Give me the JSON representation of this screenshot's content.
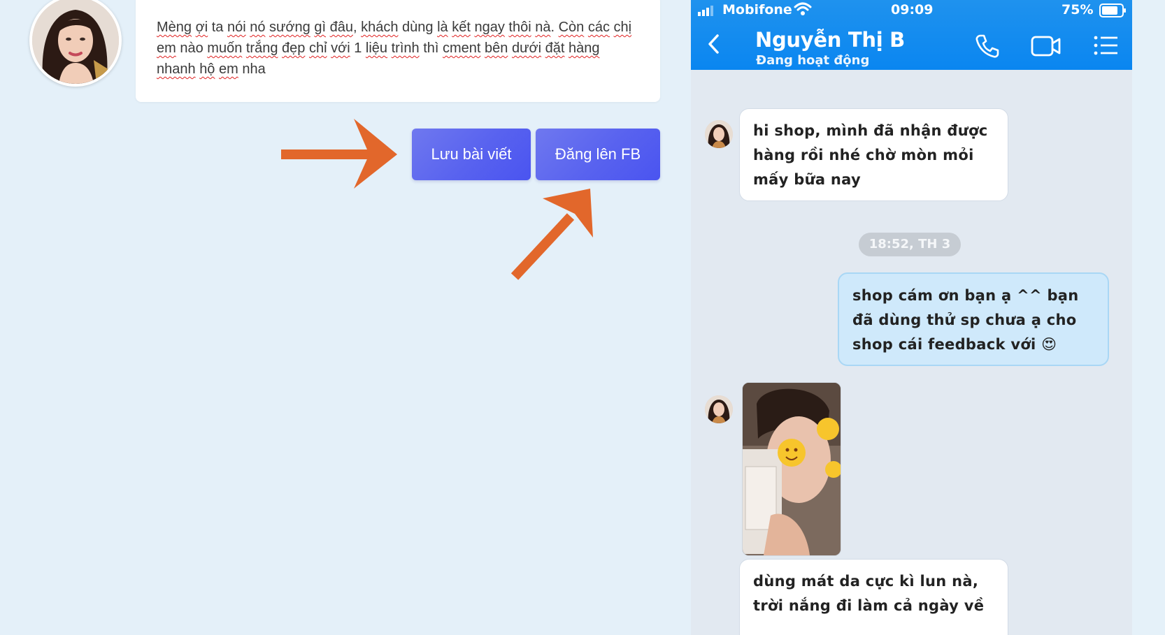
{
  "post": {
    "words": [
      {
        "t": "Mèng",
        "sp": true
      },
      {
        "t": " ",
        "sp": false
      },
      {
        "t": "ợi",
        "sp": true
      },
      {
        "t": " ta ",
        "sp": false
      },
      {
        "t": "nói",
        "sp": true
      },
      {
        "t": " ",
        "sp": false
      },
      {
        "t": "nó",
        "sp": true
      },
      {
        "t": " ",
        "sp": false
      },
      {
        "t": "sướng",
        "sp": true
      },
      {
        "t": " ",
        "sp": false
      },
      {
        "t": "gì",
        "sp": true
      },
      {
        "t": " ",
        "sp": false
      },
      {
        "t": "đâu",
        "sp": true
      },
      {
        "t": ", ",
        "sp": false
      },
      {
        "t": "khách",
        "sp": true
      },
      {
        "t": " dùng ",
        "sp": false
      },
      {
        "t": "là",
        "sp": true
      },
      {
        "t": " ",
        "sp": false
      },
      {
        "t": "kết",
        "sp": true
      },
      {
        "t": " ",
        "sp": false
      },
      {
        "t": "ngay",
        "sp": true
      },
      {
        "t": " ",
        "sp": false
      },
      {
        "t": "thôi",
        "sp": true
      },
      {
        "t": " ",
        "sp": false
      },
      {
        "t": "nà",
        "sp": true
      },
      {
        "t": ". ",
        "sp": false
      },
      {
        "t": "Còn",
        "sp": true
      },
      {
        "t": " ",
        "sp": false
      },
      {
        "t": "các",
        "sp": true
      },
      {
        "t": " ",
        "sp": false
      },
      {
        "t": "chị",
        "sp": true
      },
      {
        "t": " ",
        "sp": false
      },
      {
        "t": "em",
        "sp": true
      },
      {
        "t": " nào ",
        "sp": false
      },
      {
        "t": "muốn",
        "sp": true
      },
      {
        "t": " ",
        "sp": false
      },
      {
        "t": "trắng",
        "sp": true
      },
      {
        "t": " ",
        "sp": false
      },
      {
        "t": "đẹp",
        "sp": true
      },
      {
        "t": " ",
        "sp": false
      },
      {
        "t": "chỉ",
        "sp": true
      },
      {
        "t": " ",
        "sp": false
      },
      {
        "t": "với",
        "sp": true
      },
      {
        "t": " 1 ",
        "sp": false
      },
      {
        "t": "liệu",
        "sp": true
      },
      {
        "t": " ",
        "sp": false
      },
      {
        "t": "trình",
        "sp": true
      },
      {
        "t": " thì ",
        "sp": false
      },
      {
        "t": "cment",
        "sp": true
      },
      {
        "t": " ",
        "sp": false
      },
      {
        "t": "bên",
        "sp": true
      },
      {
        "t": " ",
        "sp": false
      },
      {
        "t": "dưới",
        "sp": true
      },
      {
        "t": " ",
        "sp": false
      },
      {
        "t": "đặt",
        "sp": true
      },
      {
        "t": " ",
        "sp": false
      },
      {
        "t": "hàng",
        "sp": true
      },
      {
        "t": " ",
        "sp": false
      },
      {
        "t": "nhanh",
        "sp": true
      },
      {
        "t": " ",
        "sp": false
      },
      {
        "t": "hộ",
        "sp": true
      },
      {
        "t": " ",
        "sp": false
      },
      {
        "t": "em",
        "sp": true
      },
      {
        "t": " nha",
        "sp": false
      }
    ]
  },
  "actions": {
    "save_label": "Lưu bài viết",
    "post_label": "Đăng lên FB",
    "button_color": "#5862ef",
    "arrow_color": "#e2672b"
  },
  "phone": {
    "status": {
      "carrier": "Mobifone",
      "time": "09:09",
      "battery": "75%"
    },
    "contact": {
      "name": "Nguyễn Thị B",
      "status": "Đang hoạt động"
    },
    "header_color": "#1a8ff0",
    "messages": {
      "m1": "hi shop, mình đã nhận được hàng rồi nhé chờ mòn mỏi mấy bữa nay",
      "time_divider": "18:52, TH 3",
      "m2": "shop cám ơn bạn ạ ^^ bạn đã dùng thử sp chưa ạ cho shop cái feedback với 😍",
      "m3": "dùng mát da cực kì lun nà, trời nắng đi làm cả ngày về"
    }
  }
}
